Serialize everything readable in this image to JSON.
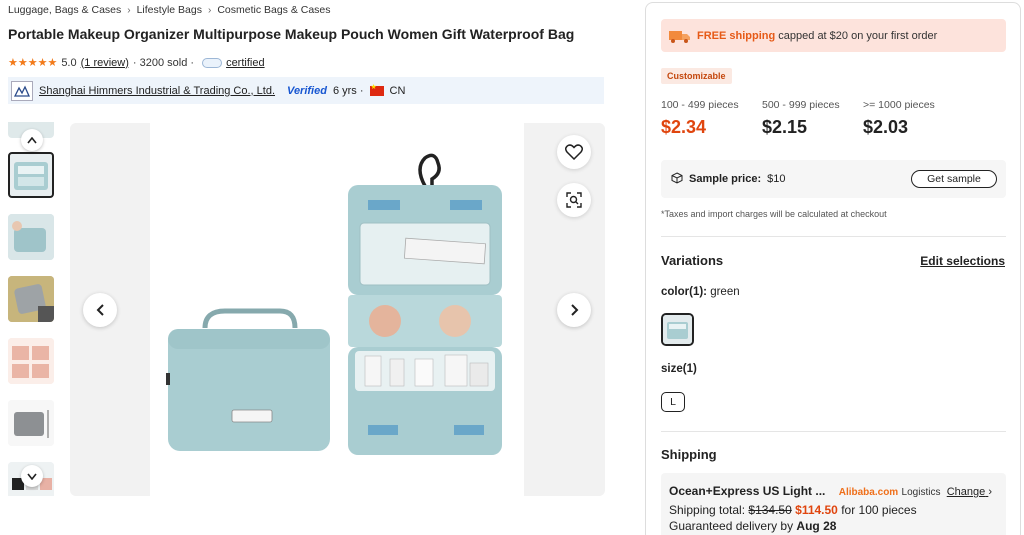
{
  "breadcrumb": [
    "Luggage, Bags & Cases",
    "Lifestyle Bags",
    "Cosmetic Bags & Cases"
  ],
  "product": {
    "title": "Portable Makeup Organizer Multipurpose Makeup Pouch Women Gift Waterproof Bag",
    "rating": "5.0",
    "review_link": "(1 review)",
    "sold": "· 3200 sold ·",
    "certified": "certified"
  },
  "supplier": {
    "name": "Shanghai Himmers Industrial & Trading Co., Ltd.",
    "verified": "Verified",
    "years": "6 yrs ·",
    "country": "CN"
  },
  "gallery": {
    "thumbnail_count": 6,
    "selected_thumbnail": 1
  },
  "offer": {
    "banner_free": "FREE shipping",
    "banner_rest": "capped at $20 on your first order",
    "customizable": "Customizable",
    "tiers": [
      {
        "range": "100 - 499 pieces",
        "price": "$2.34"
      },
      {
        "range": "500 - 999 pieces",
        "price": "$2.15"
      },
      {
        "range": ">= 1000 pieces",
        "price": "$2.03"
      }
    ],
    "sample_label": "Sample price:",
    "sample_price": "$10",
    "get_sample": "Get sample",
    "tax_note": "*Taxes and import charges will be calculated at checkout"
  },
  "variations": {
    "title": "Variations",
    "edit": "Edit selections",
    "color_label": "color(1):",
    "color_value": "green",
    "size_label": "size(1)",
    "size_value": "L"
  },
  "shipping": {
    "title": "Shipping",
    "method": "Ocean+Express US Light ...",
    "carrier": "Alibaba.com",
    "carrier_suffix": "Logistics",
    "change": "Change",
    "total_label": "Shipping total:",
    "old_price": "$134.50",
    "new_price": "$114.50",
    "qty": "for 100 pieces",
    "delivery_label": "Guaranteed delivery by",
    "delivery_date": "Aug 28"
  },
  "colors": {
    "accent": "#e0450e",
    "banner_bg": "#fde3dc",
    "supplier_bg": "#eef4fb",
    "bag_teal": "#a9cdd1"
  }
}
